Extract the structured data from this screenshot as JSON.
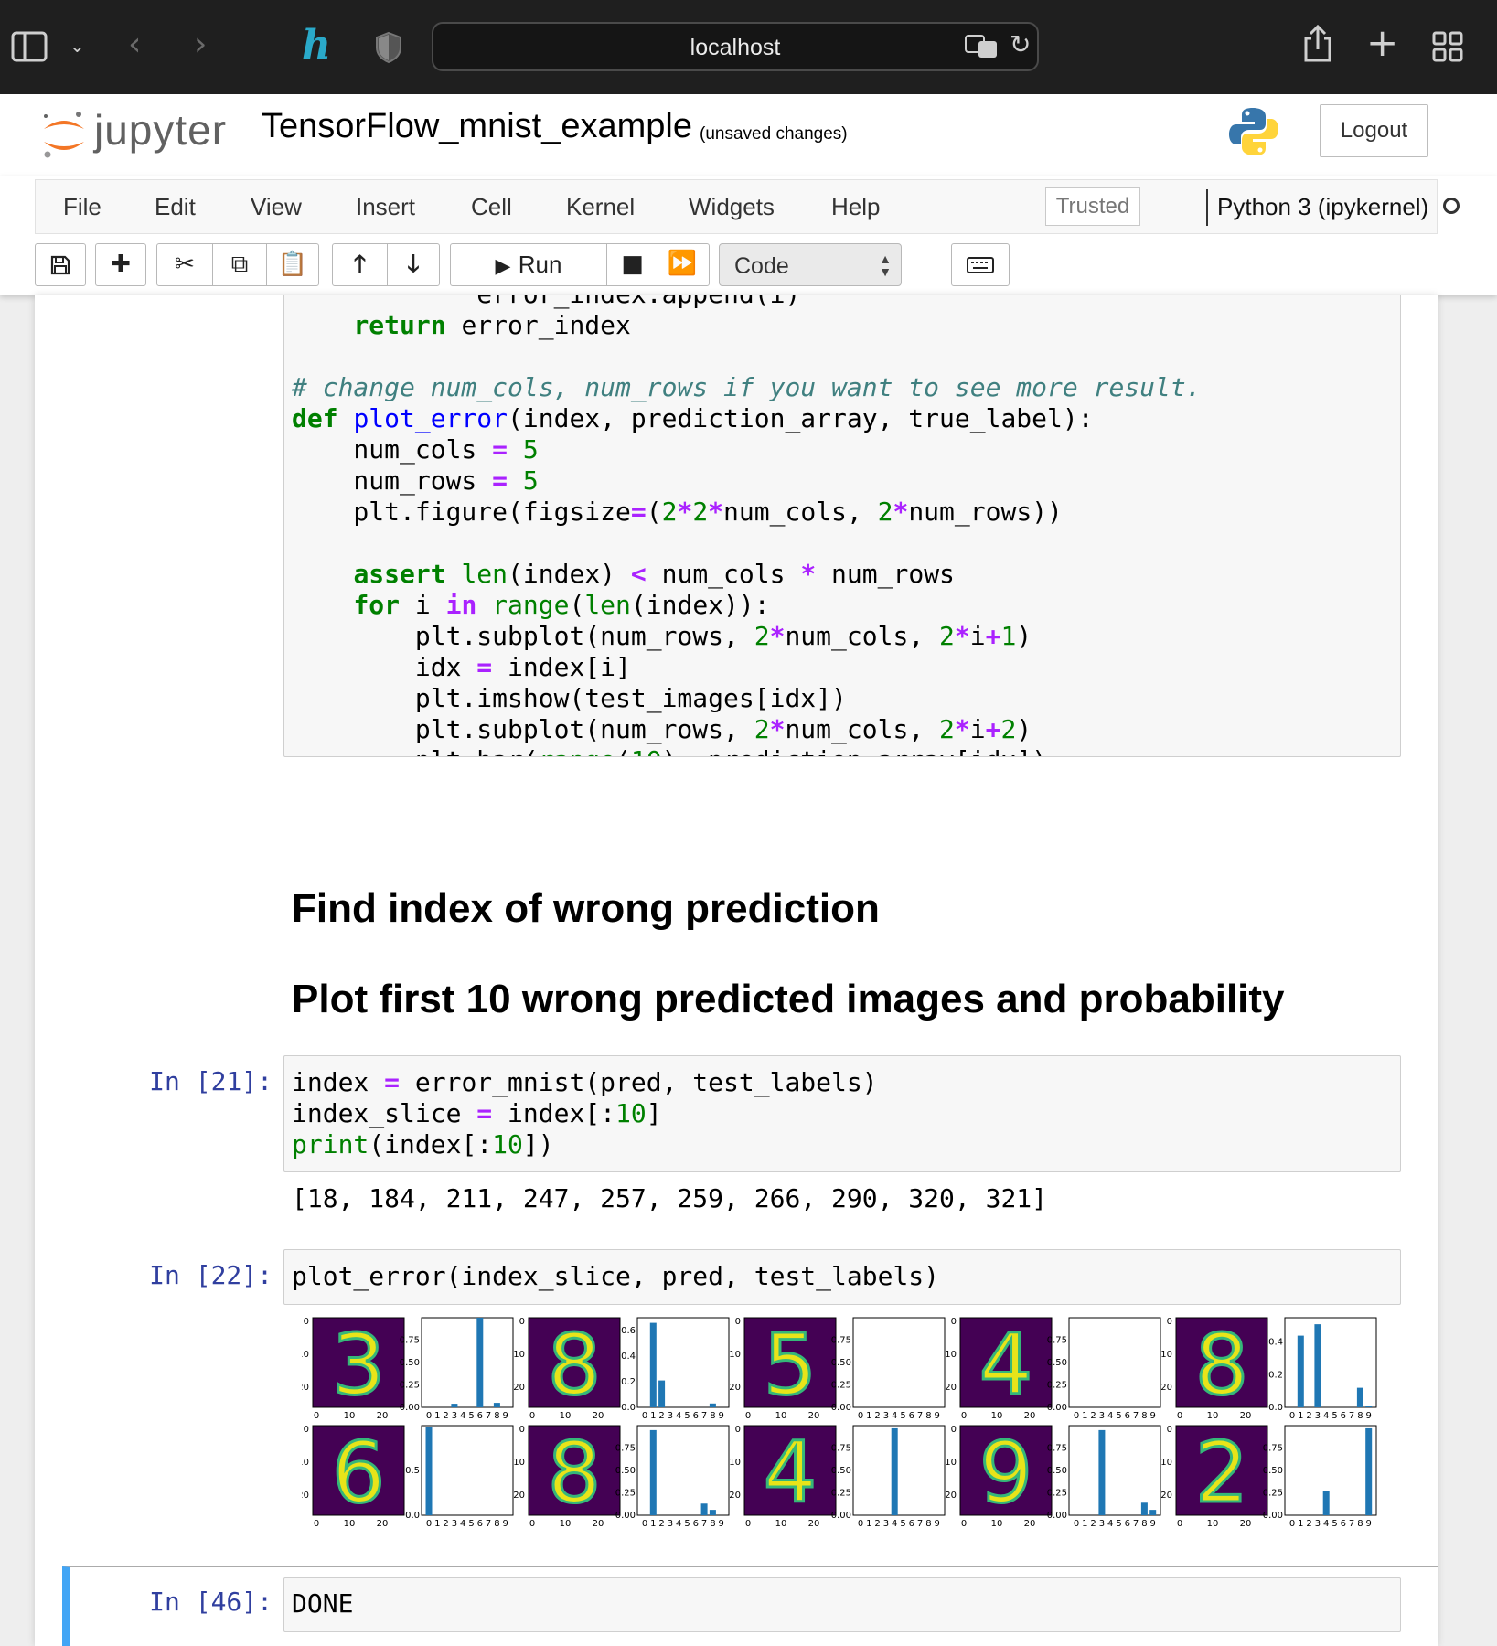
{
  "browser": {
    "url": "localhost"
  },
  "header": {
    "logo_text": "jupyter",
    "notebook_title": "TensorFlow_mnist_example",
    "save_status": "(unsaved changes)",
    "logout_label": "Logout"
  },
  "menu": {
    "items": [
      "File",
      "Edit",
      "View",
      "Insert",
      "Cell",
      "Kernel",
      "Widgets",
      "Help"
    ],
    "trusted_label": "Trusted",
    "kernel_name": "Python 3 (ipykernel)"
  },
  "toolbar": {
    "run_label": "Run",
    "cell_type": "Code"
  },
  "cells": {
    "md1": "Find index of wrong prediction",
    "md2": "Plot first 10 wrong predicted images and probability",
    "c21": {
      "prompt": "In [21]:",
      "output": "[18, 184, 211, 247, 257, 259, 266, 290, 320, 321]"
    },
    "c22": {
      "prompt": "In [22]:"
    },
    "c46": {
      "prompt": "In [46]:",
      "code": "DONE"
    }
  },
  "chart_data": {
    "type": "bar",
    "categories": [
      "0",
      "1",
      "2",
      "3",
      "4",
      "5",
      "6",
      "7",
      "8",
      "9"
    ],
    "image_axis_ticks": [
      "0",
      "10",
      "20"
    ],
    "panels": [
      {
        "digit": "3",
        "ylim": [
          0,
          1.0
        ],
        "yticks": [
          "0.00",
          "0.25",
          "0.50",
          "0.75"
        ],
        "values": [
          0,
          0,
          0,
          0.04,
          0,
          0,
          1.0,
          0,
          0.05,
          0
        ]
      },
      {
        "digit": "8",
        "ylim": [
          0,
          0.7
        ],
        "yticks": [
          "0.0",
          "0.2",
          "0.4",
          "0.6"
        ],
        "values": [
          0,
          0.66,
          0.21,
          0,
          0,
          0,
          0,
          0,
          0.03,
          0
        ]
      },
      {
        "digit": "5",
        "ylim": [
          0,
          1.0
        ],
        "yticks": [
          "0.00",
          "0.25",
          "0.50",
          "0.75"
        ],
        "values": [
          0,
          0,
          0,
          0,
          0,
          0,
          0,
          0,
          0,
          0
        ],
        "note": ""
      },
      {
        "digit": "4",
        "ylim": [
          0,
          1.0
        ],
        "yticks": [
          "0.00",
          "0.25",
          "0.50",
          "0.75"
        ],
        "values": [
          0,
          0,
          0,
          0,
          0,
          0,
          0,
          0,
          0,
          0
        ]
      },
      {
        "digit": "8",
        "ylim": [
          0,
          0.55
        ],
        "yticks": [
          "0.0",
          "0.2",
          "0.4"
        ],
        "values": [
          0,
          0.44,
          0,
          0.51,
          0,
          0,
          0,
          0,
          0.12,
          0.01
        ]
      },
      {
        "digit": "6",
        "ylim": [
          0,
          1.0
        ],
        "yticks": [
          "0.0",
          "0.5"
        ],
        "values": [
          0.98,
          0,
          0,
          0,
          0,
          0,
          0,
          0,
          0,
          0
        ]
      },
      {
        "digit": "8",
        "ylim": [
          0,
          1.0
        ],
        "yticks": [
          "0.00",
          "0.25",
          "0.50",
          "0.75"
        ],
        "values": [
          0,
          0.95,
          0,
          0,
          0,
          0,
          0,
          0.13,
          0.06,
          0
        ]
      },
      {
        "digit": "4",
        "ylim": [
          0,
          1.0
        ],
        "yticks": [
          "0.00",
          "0.25",
          "0.50",
          "0.75"
        ],
        "values": [
          0,
          0,
          0,
          0,
          0.97,
          0,
          0,
          0,
          0,
          0
        ]
      },
      {
        "digit": "9",
        "ylim": [
          0,
          1.0
        ],
        "yticks": [
          "0.00",
          "0.25",
          "0.50",
          "0.75"
        ],
        "values": [
          0,
          0,
          0,
          0.95,
          0,
          0,
          0,
          0,
          0.14,
          0.06
        ]
      },
      {
        "digit": "2",
        "ylim": [
          0,
          1.0
        ],
        "yticks": [
          "0.00",
          "0.25",
          "0.50",
          "0.75"
        ],
        "values": [
          0,
          0,
          0,
          0,
          0.27,
          0,
          0,
          0,
          0,
          0.97
        ]
      }
    ]
  }
}
